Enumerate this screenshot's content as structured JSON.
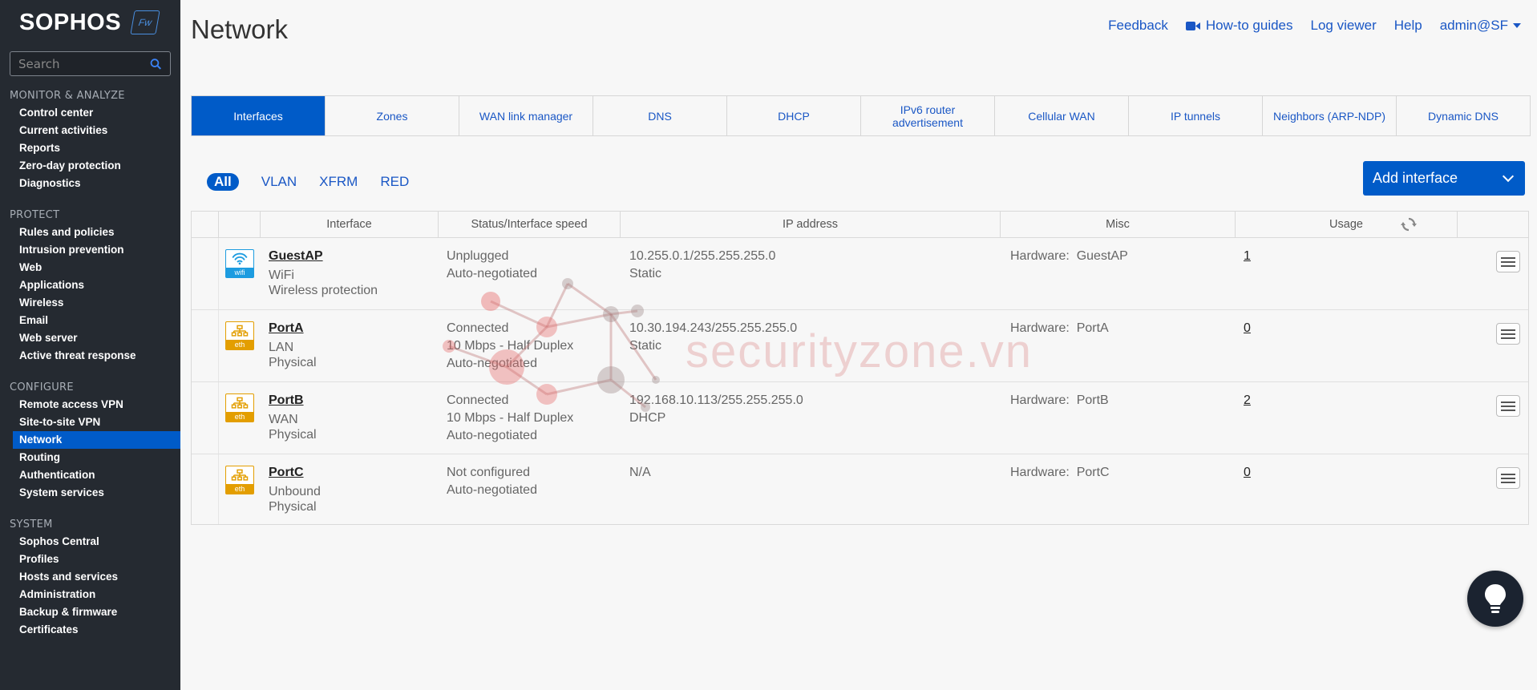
{
  "sidebar": {
    "logo": "SOPHOS",
    "logo_badge": "Fw",
    "search_placeholder": "Search",
    "sections": [
      {
        "title": "MONITOR & ANALYZE",
        "items": [
          "Control center",
          "Current activities",
          "Reports",
          "Zero-day protection",
          "Diagnostics"
        ]
      },
      {
        "title": "PROTECT",
        "items": [
          "Rules and policies",
          "Intrusion prevention",
          "Web",
          "Applications",
          "Wireless",
          "Email",
          "Web server",
          "Active threat response"
        ]
      },
      {
        "title": "CONFIGURE",
        "items": [
          "Remote access VPN",
          "Site-to-site VPN",
          "Network",
          "Routing",
          "Authentication",
          "System services"
        ]
      },
      {
        "title": "SYSTEM",
        "items": [
          "Sophos Central",
          "Profiles",
          "Hosts and services",
          "Administration",
          "Backup & firmware",
          "Certificates"
        ]
      }
    ],
    "active_item": "Network"
  },
  "header": {
    "title": "Network",
    "links": {
      "feedback": "Feedback",
      "howto": "How-to guides",
      "logviewer": "Log viewer",
      "help": "Help",
      "user": "admin@SF"
    }
  },
  "tabs": [
    "Interfaces",
    "Zones",
    "WAN link manager",
    "DNS",
    "DHCP",
    "IPv6 router advertisement",
    "Cellular WAN",
    "IP tunnels",
    "Neighbors (ARP-NDP)",
    "Dynamic DNS"
  ],
  "filters": [
    "All",
    "VLAN",
    "XFRM",
    "RED"
  ],
  "add_button": "Add interface",
  "table": {
    "headers": {
      "interface": "Interface",
      "status": "Status/Interface speed",
      "ip": "IP address",
      "misc": "Misc",
      "usage": "Usage"
    },
    "rows": [
      {
        "name": "GuestAP",
        "type": "WiFi",
        "kind": "Wireless protection",
        "icon_label": "wifi",
        "status": "Unplugged",
        "speed": "",
        "negotiation": "Auto-negotiated",
        "ip": "10.255.0.1/255.255.255.0",
        "ip_mode": "Static",
        "hw_label": "Hardware:",
        "hardware": "GuestAP",
        "usage": "1"
      },
      {
        "name": "PortA",
        "type": "LAN",
        "kind": "Physical",
        "icon_label": "eth",
        "status": "Connected",
        "speed": "10 Mbps - Half Duplex",
        "negotiation": "Auto-negotiated",
        "ip": "10.30.194.243/255.255.255.0",
        "ip_mode": "Static",
        "hw_label": "Hardware:",
        "hardware": "PortA",
        "usage": "0"
      },
      {
        "name": "PortB",
        "type": "WAN",
        "kind": "Physical",
        "icon_label": "eth",
        "status": "Connected",
        "speed": "10 Mbps - Half Duplex",
        "negotiation": "Auto-negotiated",
        "ip": "192.168.10.113/255.255.255.0",
        "ip_mode": "DHCP",
        "hw_label": "Hardware:",
        "hardware": "PortB",
        "usage": "2"
      },
      {
        "name": "PortC",
        "type": "Unbound",
        "kind": "Physical",
        "icon_label": "eth",
        "status": "Not configured",
        "speed": "",
        "negotiation": "Auto-negotiated",
        "ip": "N/A",
        "ip_mode": "",
        "hw_label": "Hardware:",
        "hardware": "PortC",
        "usage": "0"
      }
    ]
  },
  "watermark": "securityzone.vn",
  "colors": {
    "accent": "#005bc8",
    "sidebar_bg": "#252a31",
    "link": "#1a57c5",
    "eth_icon": "#e39e00",
    "wifi_icon": "#1d9ce0"
  }
}
